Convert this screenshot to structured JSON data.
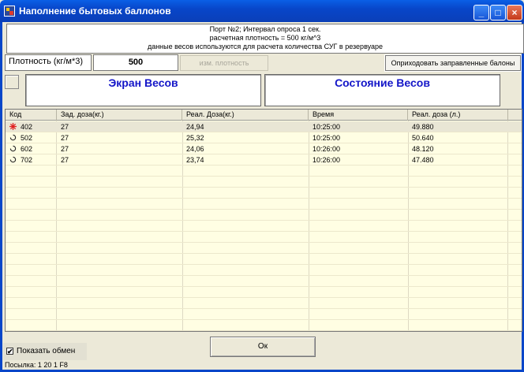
{
  "window": {
    "title": "Наполнение бытовых баллонов",
    "minimize_label": "_",
    "maximize_label": "□",
    "close_label": "×"
  },
  "info": {
    "line1": "Порт №2; Интервал опроса 1 сек.",
    "line2": "расчетная плотность = 500 кг/м^3",
    "line3": "данные весов используются для расчета количества СУГ в резервуаре"
  },
  "density": {
    "label": "Плотность (кг/м*3)",
    "value": "500",
    "change_button": "изм. плотность"
  },
  "record_button": "Оприходовать заправленные балоны",
  "screens": {
    "scale_title": "Экран Весов",
    "status_title": "Состояние Весов"
  },
  "table": {
    "columns": [
      "Код",
      "Зад. доза(кг.)",
      "Реал. Доза(кг.)",
      "Время",
      "Реал. доза (л.)"
    ],
    "rows": [
      {
        "code": "402",
        "set_dose": "27",
        "real_dose_kg": "24,94",
        "time": "10:25:00",
        "real_dose_l": "49.880",
        "icon": "burst-icon"
      },
      {
        "code": "502",
        "set_dose": "27",
        "real_dose_kg": "25,32",
        "time": "10:25:00",
        "real_dose_l": "50.640",
        "icon": "spinner-icon"
      },
      {
        "code": "602",
        "set_dose": "27",
        "real_dose_kg": "24,06",
        "time": "10:26:00",
        "real_dose_l": "48.120",
        "icon": "spinner-icon"
      },
      {
        "code": "702",
        "set_dose": "27",
        "real_dose_kg": "23,74",
        "time": "10:26:00",
        "real_dose_l": "47.480",
        "icon": "spinner-icon"
      }
    ]
  },
  "show_exchange": {
    "label": "Показать обмен",
    "checked": true,
    "check_mark": "✔"
  },
  "ok_label": "Ок",
  "status_line": "Посылка: 1 20 1 F8",
  "colors": {
    "title_bar": "#0846c9",
    "screen_title": "#1416c8",
    "table_bg": "#fffee3",
    "burst_icon": "#e02020"
  }
}
